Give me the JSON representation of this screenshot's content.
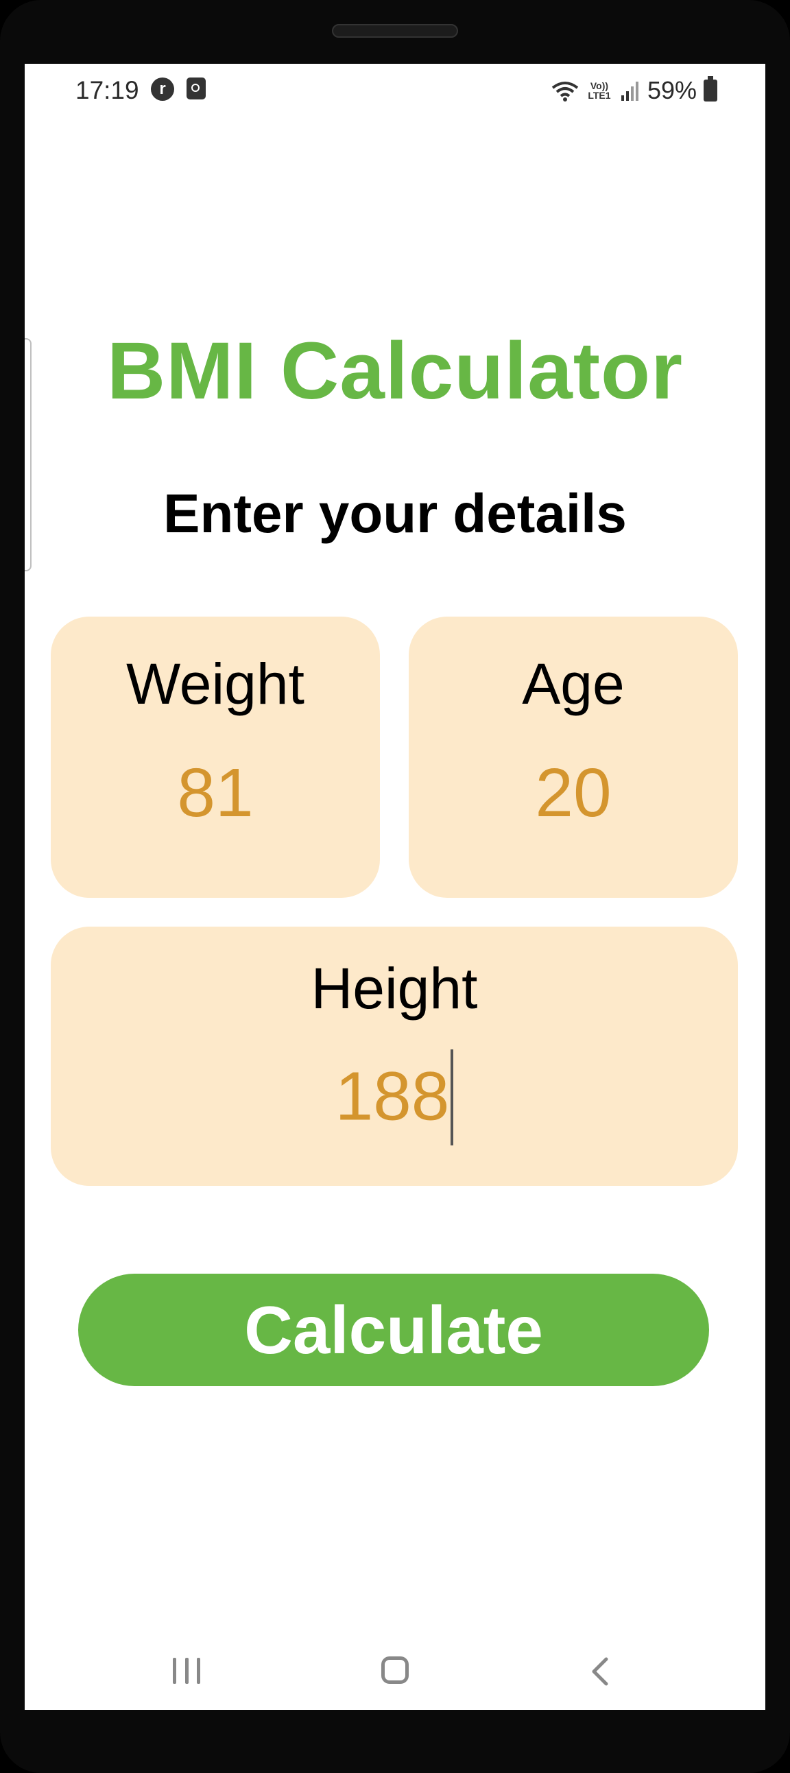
{
  "status_bar": {
    "time": "17:19",
    "battery_percent": "59%",
    "network_label": "Vo)) LTE1",
    "icons": [
      "notification-r-icon",
      "alarm-icon",
      "wifi-icon",
      "signal-icon",
      "battery-icon"
    ]
  },
  "app": {
    "title": "BMI Calculator",
    "subtitle": "Enter your details"
  },
  "fields": {
    "weight": {
      "label": "Weight",
      "value": "81"
    },
    "age": {
      "label": "Age",
      "value": "20"
    },
    "height": {
      "label": "Height",
      "value": "188"
    }
  },
  "actions": {
    "calculate_label": "Calculate"
  },
  "colors": {
    "accent_green": "#67b745",
    "card_background": "#fde9ca",
    "value_color": "#d4952e"
  },
  "nav_bar": {
    "icons": [
      "recent-apps-icon",
      "home-icon",
      "back-icon"
    ]
  }
}
